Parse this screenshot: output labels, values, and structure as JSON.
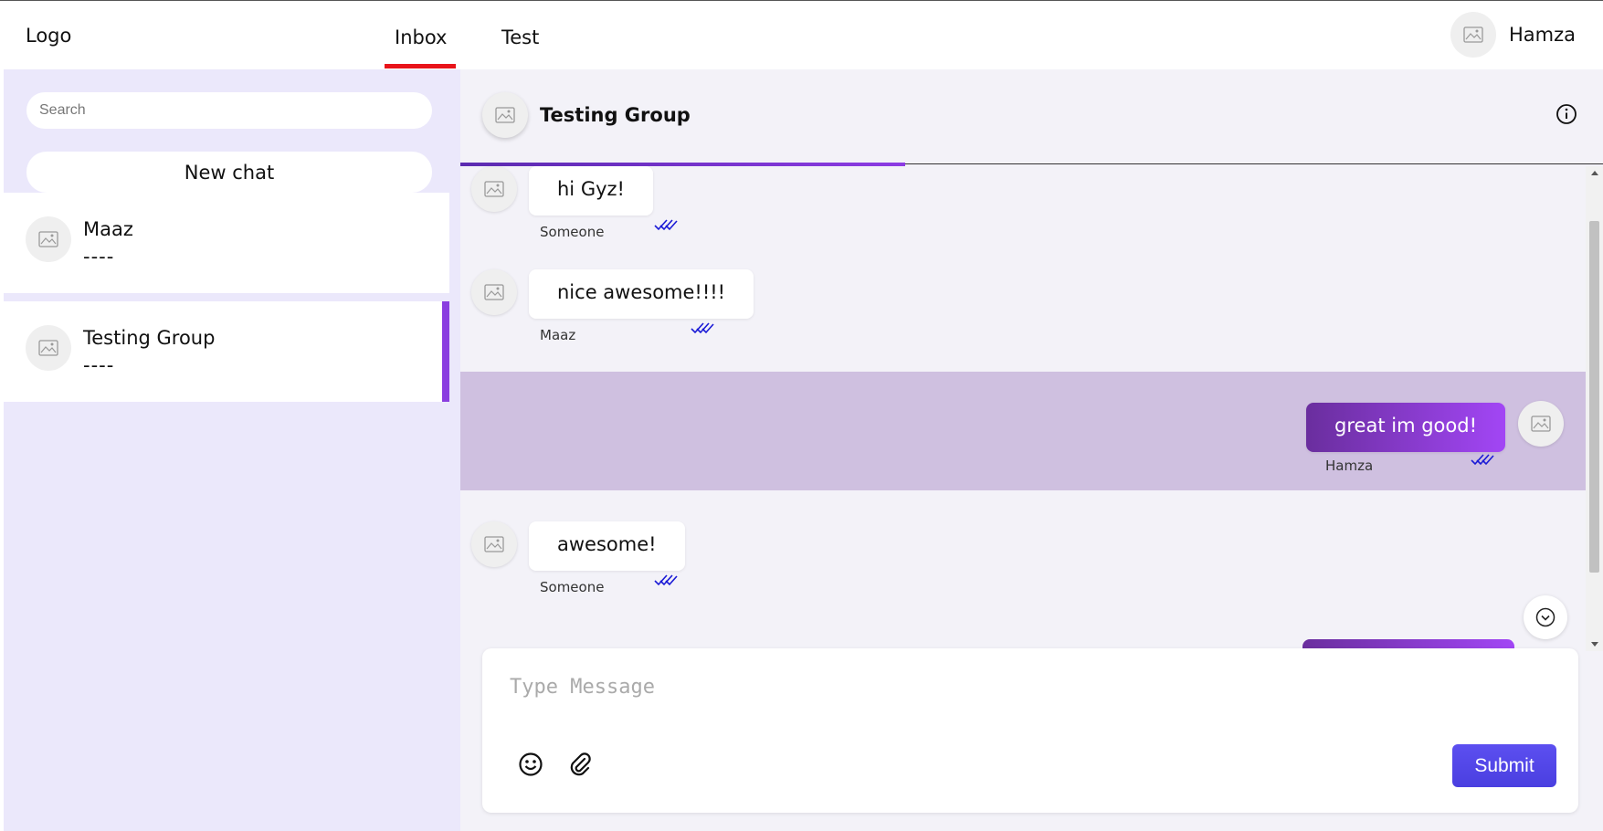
{
  "header": {
    "logo": "Logo",
    "tabs": [
      {
        "label": "Inbox",
        "active": true
      },
      {
        "label": "Test",
        "active": false
      }
    ],
    "user_name": "Hamza"
  },
  "sidebar": {
    "search_placeholder": "Search",
    "new_chat_label": "New chat",
    "chats": [
      {
        "name": "Maaz",
        "preview": "----",
        "active": false
      },
      {
        "name": "Testing Group",
        "preview": "----",
        "active": true
      }
    ]
  },
  "chat": {
    "title": "Testing Group",
    "messages": [
      {
        "text": "hi Gyz!",
        "sender": "Someone",
        "mine": false
      },
      {
        "text": "nice awesome!!!!",
        "sender": "Maaz",
        "mine": false
      },
      {
        "text": "great im good!",
        "sender": "Hamza",
        "mine": true
      },
      {
        "text": "awesome!",
        "sender": "Someone",
        "mine": false
      }
    ],
    "composer_placeholder": "Type Message",
    "submit_label": "Submit"
  },
  "colors": {
    "accent": "#8a3ee0",
    "tab_underline": "#e8141a",
    "submit": "#4f45e8",
    "highlight_row": "#cfc0e0",
    "read_tick": "#1a1ad6"
  },
  "icons": [
    "image-placeholder-icon",
    "info-icon",
    "emoji-icon",
    "paperclip-icon",
    "chevron-down-circle-icon",
    "double-check-icon"
  ]
}
